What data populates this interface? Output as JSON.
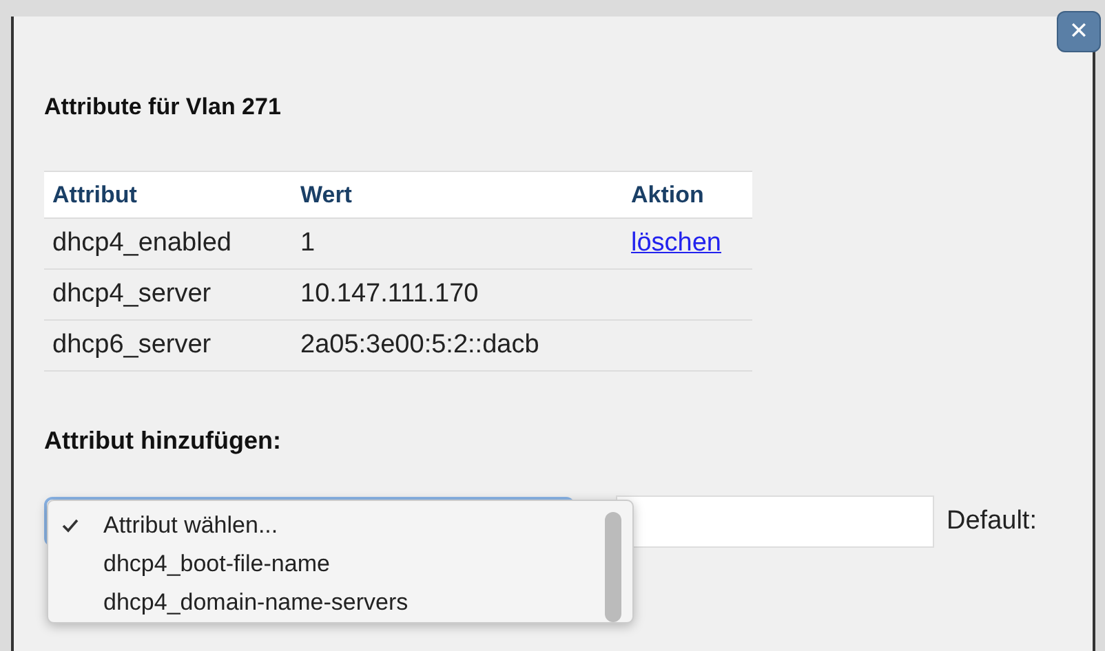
{
  "dialog": {
    "title": "Attribute für Vlan 271",
    "close_icon": "✕"
  },
  "table": {
    "columns": [
      "Attribut",
      "Wert",
      "Aktion"
    ],
    "rows": [
      {
        "attribute": "dhcp4_enabled",
        "value": "1",
        "action": "löschen"
      },
      {
        "attribute": "dhcp4_server",
        "value": "10.147.111.170"
      },
      {
        "attribute": "dhcp6_server",
        "value": "2a05:3e00:5:2::dacb"
      }
    ]
  },
  "add_section": {
    "heading": "Attribut hinzufügen:",
    "default_label": "Default:",
    "dropdown_options": [
      {
        "label": "Attribut wählen...",
        "selected": true
      },
      {
        "label": "dhcp4_boot-file-name",
        "selected": false
      },
      {
        "label": "dhcp4_domain-name-servers",
        "selected": false
      }
    ]
  }
}
